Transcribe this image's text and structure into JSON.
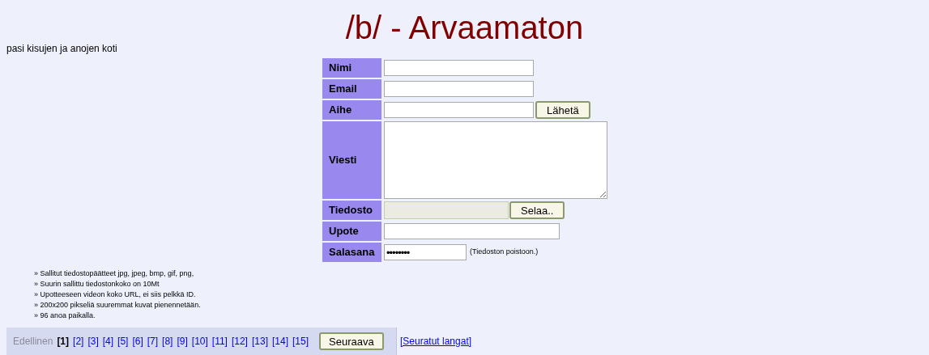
{
  "header": {
    "title": "/b/ - Arvaamaton",
    "subtitle": "pasi kisujen ja anojen koti"
  },
  "form": {
    "rows": [
      {
        "label": "Nimi",
        "kind": "text"
      },
      {
        "label": "Email",
        "kind": "text"
      },
      {
        "label": "Aihe",
        "kind": "text",
        "button": "Lähetä"
      },
      {
        "label": "Viesti",
        "kind": "textarea"
      },
      {
        "label": "Tiedosto",
        "kind": "file",
        "button": "Selaa.."
      },
      {
        "label": "Upote",
        "kind": "url"
      },
      {
        "label": "Salasana",
        "kind": "password",
        "value": "••••••••",
        "note": "(Tiedoston poistoon.)"
      }
    ]
  },
  "rules": [
    "» Sallitut tiedostopäätteet jpg, jpeg, bmp, gif, png,",
    "» Suurin sallittu tiedostonkoko on 10Mt",
    "» Upotteeseen videon koko URL, ei siis pelkkä ID.",
    "» 200x200 pikseliä suuremmat kuvat pienennetään.",
    "» 96 anoa paikalla."
  ],
  "pagination": {
    "previous": "Edellinen",
    "pages": [
      {
        "label": "[1]",
        "selected": true
      },
      {
        "label": "[2]",
        "selected": false
      },
      {
        "label": "[3]",
        "selected": false
      },
      {
        "label": "[4]",
        "selected": false
      },
      {
        "label": "[5]",
        "selected": false
      },
      {
        "label": "[6]",
        "selected": false
      },
      {
        "label": "[7]",
        "selected": false
      },
      {
        "label": "[8]",
        "selected": false
      },
      {
        "label": "[9]",
        "selected": false
      },
      {
        "label": "[10]",
        "selected": false
      },
      {
        "label": "[11]",
        "selected": false
      },
      {
        "label": "[12]",
        "selected": false
      },
      {
        "label": "[13]",
        "selected": false
      },
      {
        "label": "[14]",
        "selected": false
      },
      {
        "label": "[15]",
        "selected": false
      }
    ],
    "next": "Seuraava",
    "followed": "[Seuratut langat]"
  }
}
